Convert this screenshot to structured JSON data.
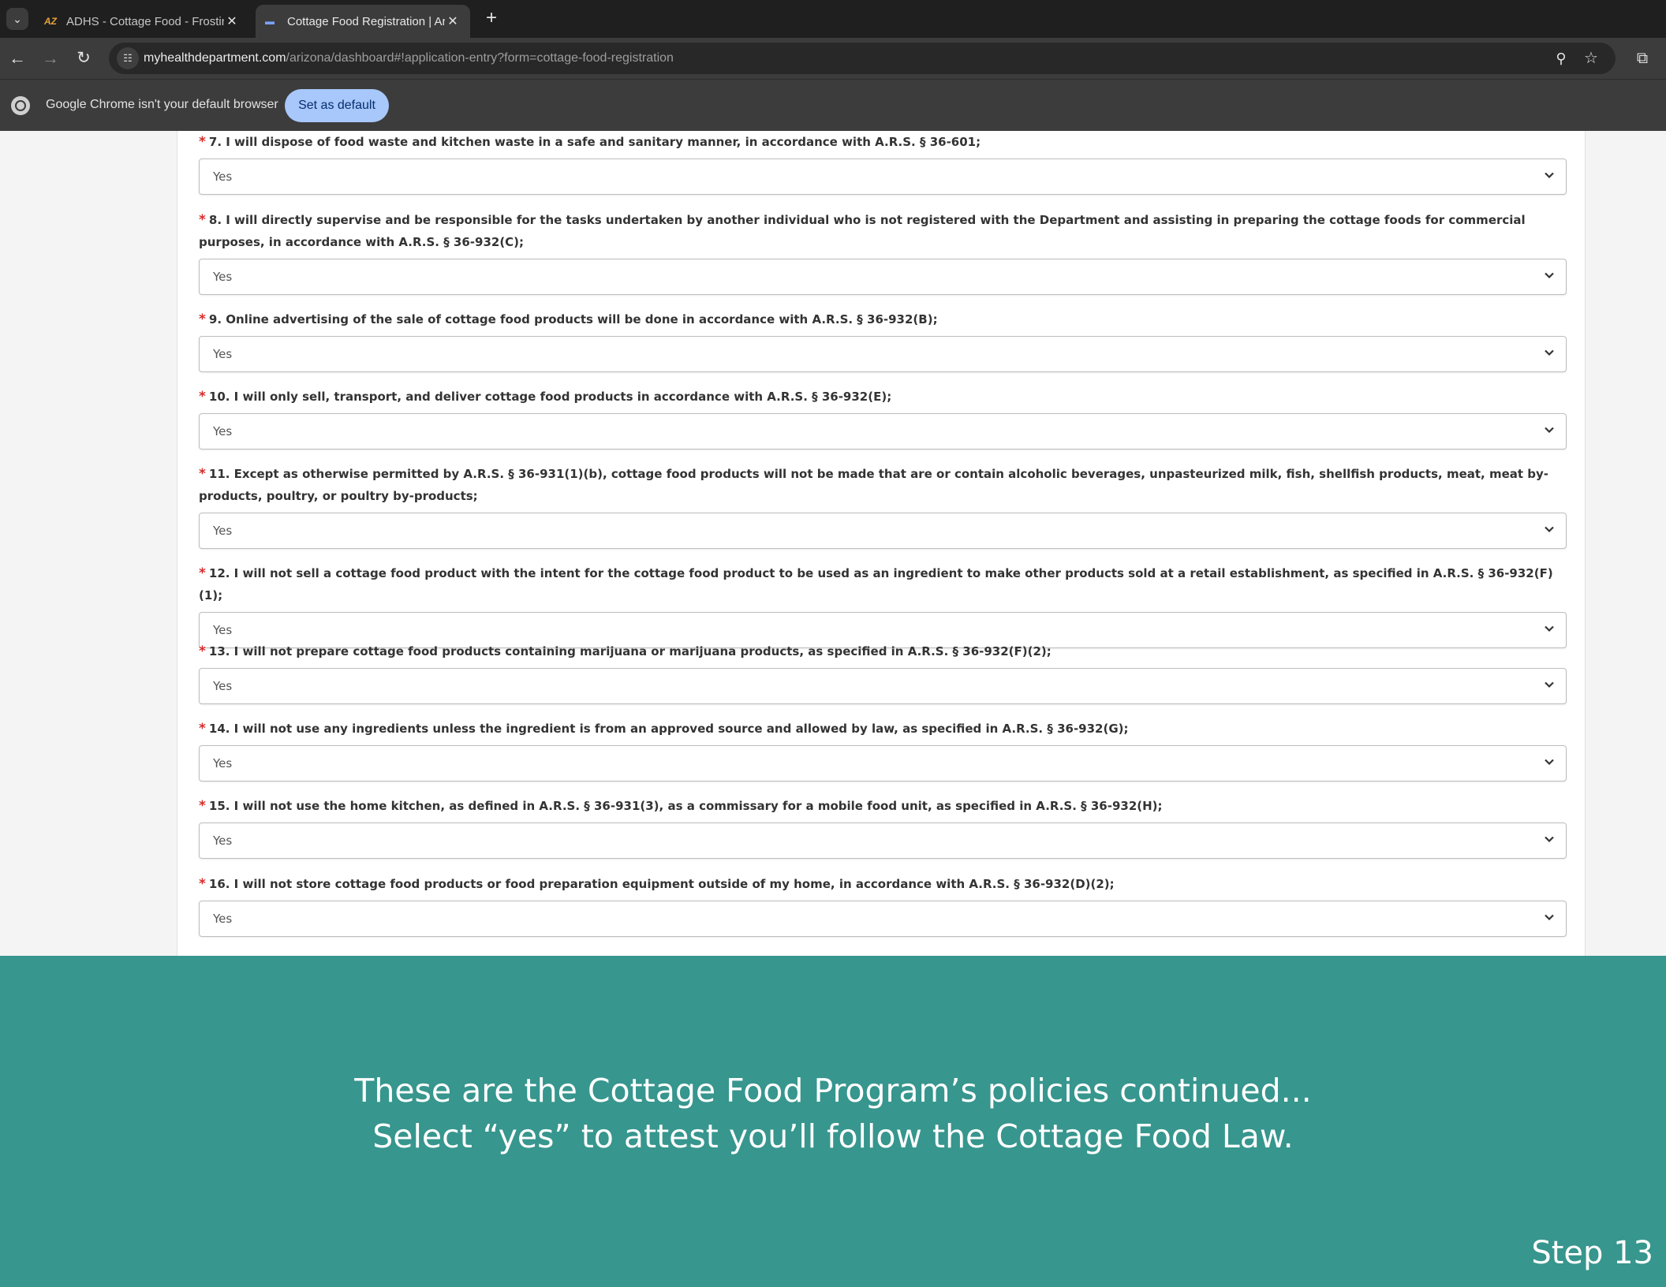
{
  "browser": {
    "tabs": [
      {
        "title": "ADHS - Cottage Food - Frosting",
        "favicon": "adhs-favicon",
        "active": false
      },
      {
        "title": "Cottage Food Registration | Arizona",
        "favicon": "myhealthdepartment-favicon",
        "active": true
      }
    ],
    "tab_close_glyph": "✕",
    "new_tab_glyph": "+",
    "url_host": "myhealthdepartment.com",
    "url_path": "/arizona/dashboard#!application-entry?form=cottage-food-registration",
    "infobar": {
      "text": "Google Chrome isn't your default browser",
      "button": "Set as default"
    },
    "colors": {
      "tabstrip": "#1f1f1f",
      "toolbar": "#3c3c3c",
      "set_default_button": "#a8c7fa"
    }
  },
  "form": {
    "required_marker": "*",
    "questions": [
      {
        "label": "7. I will dispose of food waste and kitchen waste in a safe and sanitary manner, in accordance with A.R.S. § 36-601;",
        "value": "Yes"
      },
      {
        "label": "8. I will directly supervise and be responsible for the tasks undertaken by another individual who is not registered with the Department and assisting in preparing the cottage foods for commercial purposes, in accordance with A.R.S. § 36-932(C);",
        "value": "Yes"
      },
      {
        "label": "9. Online advertising of the sale of cottage food products will be done in accordance with A.R.S. § 36-932(B);",
        "value": "Yes"
      },
      {
        "label": "10. I will only sell, transport, and deliver cottage food products in accordance with A.R.S. § 36-932(E);",
        "value": "Yes"
      },
      {
        "label": "11. Except as otherwise permitted by A.R.S. § 36-931(1)(b), cottage food products will not be made that are or contain alcoholic beverages, unpasteurized milk, fish, shellfish products, meat, meat by-products, poultry, or poultry by-products;",
        "value": "Yes"
      },
      {
        "label": "12. I will not sell a cottage food product with the intent for the cottage food product to be used as an ingredient to make other products sold at a retail establishment, as specified in A.R.S. § 36-932(F)(1);",
        "value": "Yes"
      },
      {
        "label": "13. I will not prepare cottage food products containing marijuana or marijuana products, as specified in A.R.S. § 36-932(F)(2);",
        "value": "Yes"
      },
      {
        "label": "14. I will not use any ingredients unless the ingredient is from an approved source and allowed by law, as specified in A.R.S. § 36-932(G);",
        "value": "Yes"
      },
      {
        "label": "15. I will not use the home kitchen, as defined in A.R.S. § 36-931(3), as a commissary for a mobile food unit, as specified in A.R.S. § 36-932(H);",
        "value": "Yes"
      },
      {
        "label": "16. I will not store cottage food products or food preparation equipment outside of my home, in accordance with A.R.S. § 36-932(D)(2);",
        "value": "Yes"
      }
    ]
  },
  "caption": {
    "line1": "These are the Cottage Food Program’s policies continued...",
    "line2": "Select “yes” to attest you’ll follow the Cottage Food Law.",
    "step": "Step 13",
    "background": "#37968e"
  }
}
